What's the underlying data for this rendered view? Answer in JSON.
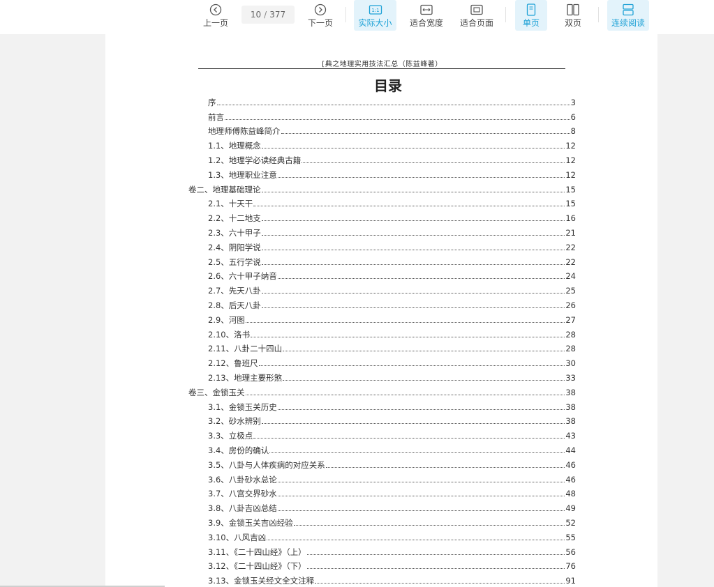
{
  "toolbar": {
    "prev_label": "上一页",
    "next_label": "下一页",
    "current_page": "10",
    "page_separator": "/",
    "total_pages": "377",
    "actual_size_label": "实际大小",
    "fit_width_label": "适合宽度",
    "fit_page_label": "适合页面",
    "single_page_label": "单页",
    "double_page_label": "双页",
    "continuous_label": "连续阅读",
    "icons": {
      "prev": "circle-chevron-left-icon",
      "next": "circle-chevron-right-icon",
      "actual_size": "one-to-one-icon",
      "fit_width": "fit-width-icon",
      "fit_page": "fit-page-icon",
      "single_page": "single-page-icon",
      "double_page": "double-page-icon",
      "continuous": "continuous-scroll-icon"
    },
    "active_color": "#1da1d6",
    "active_background": "#e3f3fb"
  },
  "document": {
    "running_header": "[典之地理实用技法汇总（陈益峰著）",
    "toc_title": "目录",
    "toc": [
      {
        "title": "序",
        "page": "3",
        "level": 1
      },
      {
        "title": "前言",
        "page": "6",
        "level": 1
      },
      {
        "title": "地理师傅陈益峰简介",
        "page": "8",
        "level": 1
      },
      {
        "title": "1.1、地理概念",
        "page": "12",
        "level": 1
      },
      {
        "title": "1.2、地理学必读经典古籍",
        "page": "12",
        "level": 1
      },
      {
        "title": "1.3、地理职业注意",
        "page": "12",
        "level": 1
      },
      {
        "title": "卷二、地理基础理论",
        "page": "15",
        "level": 0
      },
      {
        "title": "2.1、十天干",
        "page": "15",
        "level": 1
      },
      {
        "title": "2.2、十二地支",
        "page": "16",
        "level": 1
      },
      {
        "title": "2.3、六十甲子",
        "page": "21",
        "level": 1
      },
      {
        "title": "2.4、阴阳学说",
        "page": "22",
        "level": 1
      },
      {
        "title": "2.5、五行学说",
        "page": "22",
        "level": 1
      },
      {
        "title": "2.6、六十甲子纳音",
        "page": "24",
        "level": 1
      },
      {
        "title": "2.7、先天八卦",
        "page": "25",
        "level": 1
      },
      {
        "title": "2.8、后天八卦",
        "page": "26",
        "level": 1
      },
      {
        "title": "2.9、河图",
        "page": "27",
        "level": 1
      },
      {
        "title": "2.10、洛书",
        "page": "28",
        "level": 1
      },
      {
        "title": "2.11、八卦二十四山",
        "page": "28",
        "level": 1
      },
      {
        "title": "2.12、鲁班尺",
        "page": "30",
        "level": 1
      },
      {
        "title": "2.13、地理主要形煞",
        "page": "33",
        "level": 1
      },
      {
        "title": "卷三、金锁玉关",
        "page": "38",
        "level": 0
      },
      {
        "title": "3.1、金锁玉关历史",
        "page": "38",
        "level": 1
      },
      {
        "title": "3.2、砂水辨别",
        "page": "38",
        "level": 1
      },
      {
        "title": "3.3、立极点",
        "page": "43",
        "level": 1
      },
      {
        "title": "3.4、房份的确认",
        "page": "44",
        "level": 1
      },
      {
        "title": "3.5、八卦与人体疾病的对应关系",
        "page": "46",
        "level": 1
      },
      {
        "title": "3.6、八卦砂水总论",
        "page": "46",
        "level": 1
      },
      {
        "title": "3.7、八宫交界砂水",
        "page": "48",
        "level": 1
      },
      {
        "title": "3.8、八卦吉凶总结",
        "page": "49",
        "level": 1
      },
      {
        "title": "3.9、金锁玉关吉凶经验",
        "page": "52",
        "level": 1
      },
      {
        "title": "3.10、八风吉凶",
        "page": "55",
        "level": 1
      },
      {
        "title": "3.11、《二十四山经》（上）",
        "page": "56",
        "level": 1
      },
      {
        "title": "3.12、《二十四山经》（下）",
        "page": "76",
        "level": 1
      },
      {
        "title": "3.13、金锁玉关经文全文注释",
        "page": "91",
        "level": 1
      }
    ]
  }
}
